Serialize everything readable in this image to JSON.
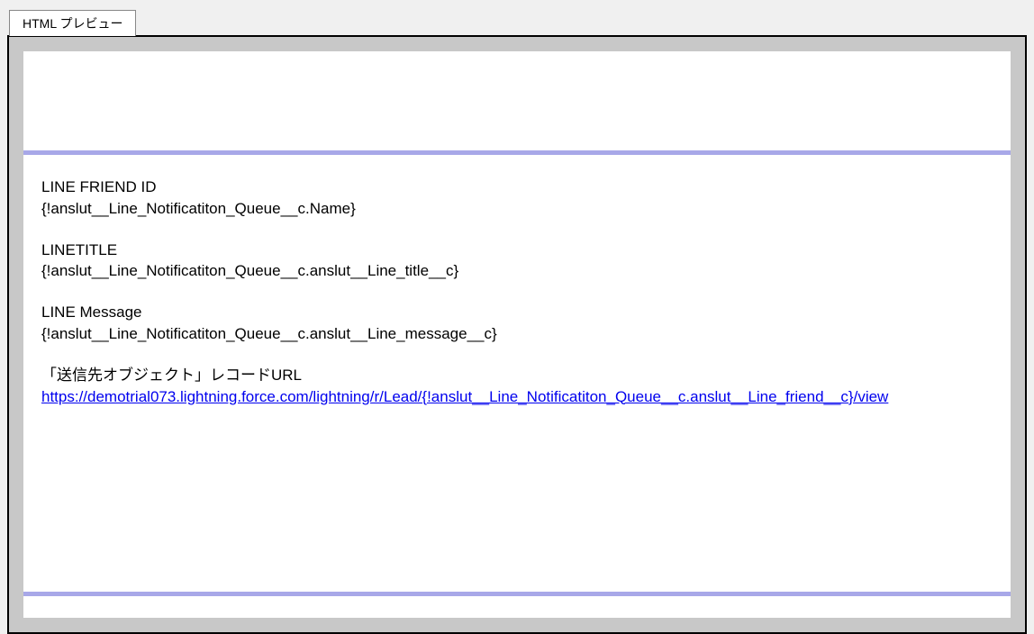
{
  "tab": {
    "label": "HTML プレビュー"
  },
  "fields": {
    "friend_id": {
      "label": "LINE FRIEND ID",
      "value": "{!anslut__Line_Notificatiton_Queue__c.Name}"
    },
    "title": {
      "label": "LINETITLE",
      "value": "{!anslut__Line_Notificatiton_Queue__c.anslut__Line_title__c}"
    },
    "message": {
      "label": "LINE Message",
      "value": "{!anslut__Line_Notificatiton_Queue__c.anslut__Line_message__c}"
    },
    "record_url": {
      "label": "「送信先オブジェクト」レコードURL",
      "value": "https://demotrial073.lightning.force.com/lightning/r/Lead/{!anslut__Line_Notificatiton_Queue__c.anslut__Line_friend__c}/view"
    }
  }
}
